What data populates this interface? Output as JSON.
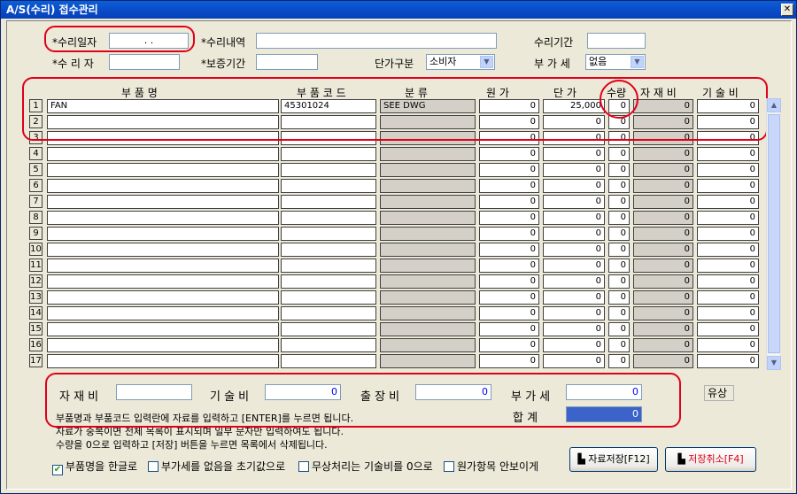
{
  "window": {
    "title": "A/S(수리) 접수관리",
    "close": "✕"
  },
  "form": {
    "repair_date_label": "*수리일자",
    "repair_date_value": ".   .",
    "repair_details_label": "*수리내역",
    "repair_details_value": "",
    "repair_period_label": "수리기간",
    "repair_period_value": "",
    "repairer_label": "*수 리 자",
    "repairer_value": "",
    "warranty_label": "*보증기간",
    "warranty_value": "",
    "price_type_label": "단가구분",
    "price_type_value": "소비자",
    "vat_label": "부 가 세",
    "vat_value": "없음"
  },
  "table": {
    "headers": {
      "part_name": "부     품     명",
      "part_code": "부 품 코 드",
      "category": "분          류",
      "cost": "원      가",
      "unit_price": "단      가",
      "qty": "수량",
      "material": "자 재 비",
      "labor": "기 술 비"
    },
    "rows": [
      {
        "n": "1",
        "name": "FAN",
        "code": "45301024",
        "cat": "SEE DWG",
        "cost": "0",
        "price": "25,000",
        "qty": "0",
        "mat": "0",
        "lab": "0"
      },
      {
        "n": "2",
        "name": "",
        "code": "",
        "cat": "",
        "cost": "0",
        "price": "0",
        "qty": "0",
        "mat": "0",
        "lab": "0"
      },
      {
        "n": "3",
        "name": "",
        "code": "",
        "cat": "",
        "cost": "0",
        "price": "0",
        "qty": "0",
        "mat": "0",
        "lab": "0"
      },
      {
        "n": "4",
        "name": "",
        "code": "",
        "cat": "",
        "cost": "0",
        "price": "0",
        "qty": "0",
        "mat": "0",
        "lab": "0"
      },
      {
        "n": "5",
        "name": "",
        "code": "",
        "cat": "",
        "cost": "0",
        "price": "0",
        "qty": "0",
        "mat": "0",
        "lab": "0"
      },
      {
        "n": "6",
        "name": "",
        "code": "",
        "cat": "",
        "cost": "0",
        "price": "0",
        "qty": "0",
        "mat": "0",
        "lab": "0"
      },
      {
        "n": "7",
        "name": "",
        "code": "",
        "cat": "",
        "cost": "0",
        "price": "0",
        "qty": "0",
        "mat": "0",
        "lab": "0"
      },
      {
        "n": "8",
        "name": "",
        "code": "",
        "cat": "",
        "cost": "0",
        "price": "0",
        "qty": "0",
        "mat": "0",
        "lab": "0"
      },
      {
        "n": "9",
        "name": "",
        "code": "",
        "cat": "",
        "cost": "0",
        "price": "0",
        "qty": "0",
        "mat": "0",
        "lab": "0"
      },
      {
        "n": "10",
        "name": "",
        "code": "",
        "cat": "",
        "cost": "0",
        "price": "0",
        "qty": "0",
        "mat": "0",
        "lab": "0"
      },
      {
        "n": "11",
        "name": "",
        "code": "",
        "cat": "",
        "cost": "0",
        "price": "0",
        "qty": "0",
        "mat": "0",
        "lab": "0"
      },
      {
        "n": "12",
        "name": "",
        "code": "",
        "cat": "",
        "cost": "0",
        "price": "0",
        "qty": "0",
        "mat": "0",
        "lab": "0"
      },
      {
        "n": "13",
        "name": "",
        "code": "",
        "cat": "",
        "cost": "0",
        "price": "0",
        "qty": "0",
        "mat": "0",
        "lab": "0"
      },
      {
        "n": "14",
        "name": "",
        "code": "",
        "cat": "",
        "cost": "0",
        "price": "0",
        "qty": "0",
        "mat": "0",
        "lab": "0"
      },
      {
        "n": "15",
        "name": "",
        "code": "",
        "cat": "",
        "cost": "0",
        "price": "0",
        "qty": "0",
        "mat": "0",
        "lab": "0"
      },
      {
        "n": "16",
        "name": "",
        "code": "",
        "cat": "",
        "cost": "0",
        "price": "0",
        "qty": "0",
        "mat": "0",
        "lab": "0"
      },
      {
        "n": "17",
        "name": "",
        "code": "",
        "cat": "",
        "cost": "0",
        "price": "0",
        "qty": "0",
        "mat": "0",
        "lab": "0"
      }
    ]
  },
  "totals": {
    "material_label": "자 재 비",
    "material_value": "",
    "labor_label": "기 술 비",
    "labor_value": "0",
    "travel_label": "출 장 비",
    "travel_value": "0",
    "vat_label": "부 가 세",
    "vat_value": "0",
    "sum_label": "합     계",
    "sum_value": "0",
    "paid_label": "유상"
  },
  "info": {
    "line1": "부품명과 부품코드 입력란에 자료를 입력하고 [ENTER]를 누르면 됩니다.",
    "line2": "자료가 중복이면 전체 목록이 표시되며 일부 문자만 입력하여도 됩니다.",
    "line3": "수량을 0으로 입력하고 [저장] 버튼을 누르면 목록에서 삭제됩니다."
  },
  "options": {
    "opt1": "부품명을 한글로",
    "opt2": "부가세를 없음을 초기값으로",
    "opt3": "무상처리는 기술비를 0으로",
    "opt4": "원가항목 안보이게",
    "opt1_checked": true
  },
  "buttons": {
    "save": "자료저장[F12]",
    "cancel": "저장취소[F4]"
  },
  "colors": {
    "highlight_red": "#e0001a",
    "title_blue": "#0a49c5",
    "sum_fill": "#3b63c9"
  }
}
